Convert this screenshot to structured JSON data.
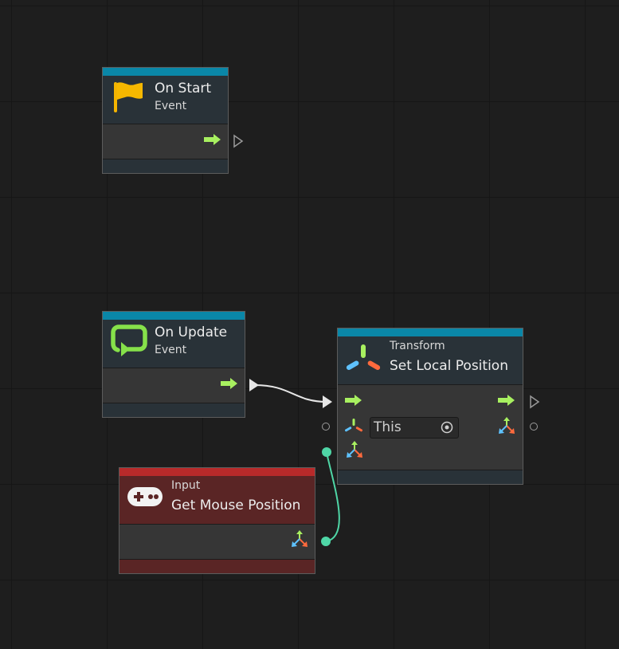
{
  "nodes": {
    "on_start": {
      "title": "On Start",
      "subtitle": "Event",
      "bar_color": "#0a87a8",
      "icon": "flag-icon"
    },
    "on_update": {
      "title": "On Update",
      "subtitle": "Event",
      "bar_color": "#0a87a8",
      "icon": "loop-icon"
    },
    "set_local_position": {
      "category": "Transform",
      "title": "Set Local Position",
      "bar_color": "#0a87a8",
      "icon": "transform-icon",
      "target_value": "This"
    },
    "get_mouse_position": {
      "category": "Input",
      "title": "Get Mouse Position",
      "bar_color": "#b82a2a",
      "icon": "gamepad-icon"
    }
  },
  "colors": {
    "flow_arrow": "#a8f060",
    "wire_value": "#4fd6a6",
    "wire_flow": "#e0e0e0"
  }
}
